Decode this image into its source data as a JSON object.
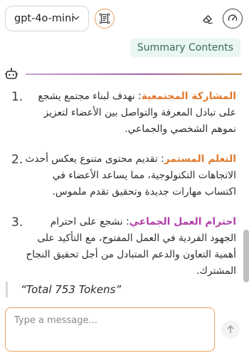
{
  "header": {
    "model_selected": "gpt-4o-mini",
    "icons": [
      "chevron-down-icon",
      "document-scan-icon",
      "eraser-icon",
      "speedometer-icon"
    ]
  },
  "summary_badge": "Summary Contents",
  "response": {
    "items": [
      {
        "number": "1.",
        "keyword": "المشاركة المجتمعية",
        "text": ": نهدف لبناء مجتمع يشجع على تبادل المعرفة والتواصل بين الأعضاء لتعزيز نموهم الشخصي والجماعي."
      },
      {
        "number": "2.",
        "keyword": "التعلم المستمر",
        "text": ": تقديم محتوى متنوع يعكس أحدث الاتجاهات التكنولوجية، مما يساعد الأعضاء في اكتساب مهارات جديدة وتحقيق تقدم ملموس."
      },
      {
        "number": "3.",
        "keyword": "احترام العمل الجماعي",
        "text": ": نشجع على احترام الجهود الفردية في العمل المفتوح، مع التأكيد على أهمية التعاون والدعم المتبادل من أجل تحقيق النجاح المشترك."
      }
    ],
    "tokens_text": "“Total 753 Tokens”"
  },
  "composer": {
    "placeholder": "Type a message...",
    "value": ""
  },
  "colors": {
    "accent_orange": "#e07a2e",
    "accent_purple": "#b23fa8",
    "badge_bg": "#e9f6f2"
  }
}
